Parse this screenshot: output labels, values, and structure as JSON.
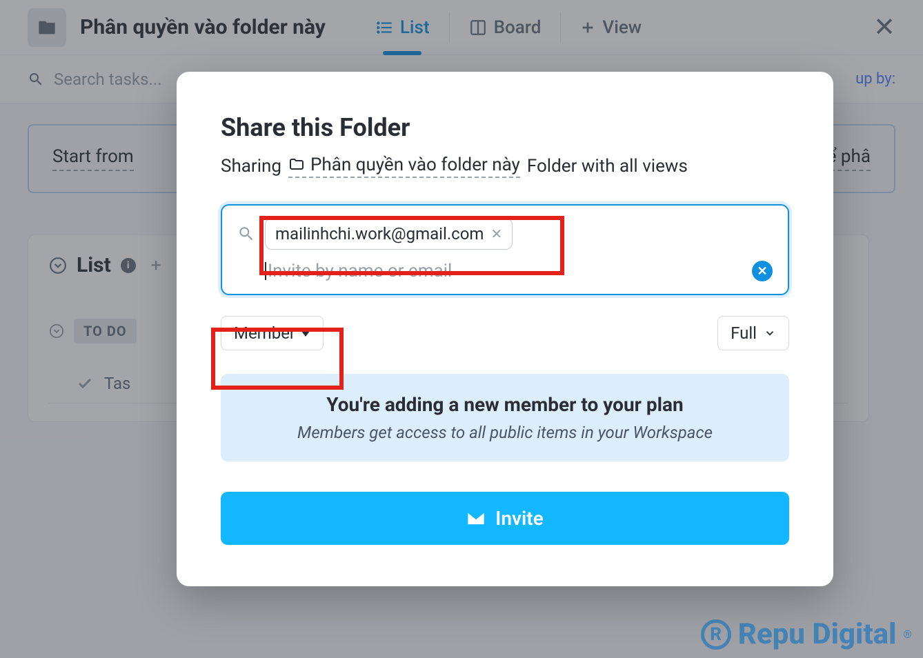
{
  "header": {
    "folder_title": "Phân quyền vào folder này",
    "tabs": [
      {
        "label": "List",
        "icon": "list-icon",
        "active": true
      },
      {
        "label": "Board",
        "icon": "board-icon",
        "active": false
      },
      {
        "label": "View",
        "icon": "plus-icon",
        "active": false
      }
    ]
  },
  "search": {
    "placeholder": "Search tasks...",
    "group_by_label": "up by:"
  },
  "background": {
    "start_from": "Start from",
    "right_snippet": "để phâ",
    "list_title": "List",
    "plus": "+",
    "todo_label": "TO DO",
    "task_label": "Tas"
  },
  "modal": {
    "title": "Share this Folder",
    "sharing_word": "Sharing",
    "folder_name": "Phân quyền vào folder này",
    "scope": "Folder with all views",
    "chip_email": "mailinhchi.work@gmail.com",
    "invite_placeholder": "Invite by name or email",
    "role_label": "Member",
    "permission_label": "Full",
    "info_title": "You're adding a new member to your plan",
    "info_sub": "Members get access to all public items in your Workspace",
    "invite_button": "Invite"
  },
  "watermark": "Repu Digital"
}
